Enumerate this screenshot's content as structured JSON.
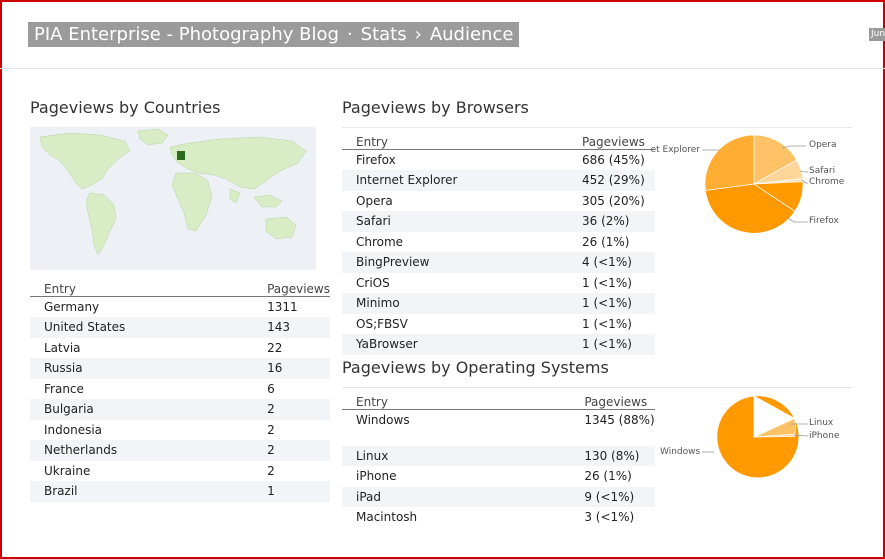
{
  "header": {
    "site": "PIA Enterprise - Photography Blog",
    "sep1": "·",
    "section": "Stats",
    "sep2": "›",
    "page": "Audience",
    "corner": "Jun"
  },
  "countries": {
    "title": "Pageviews by Countries",
    "col_entry": "Entry",
    "col_views": "Pageviews",
    "rows": [
      {
        "entry": "Germany",
        "views": "1311"
      },
      {
        "entry": "United States",
        "views": "143"
      },
      {
        "entry": "Latvia",
        "views": "22"
      },
      {
        "entry": "Russia",
        "views": "16"
      },
      {
        "entry": "France",
        "views": "6"
      },
      {
        "entry": "Bulgaria",
        "views": "2"
      },
      {
        "entry": "Indonesia",
        "views": "2"
      },
      {
        "entry": "Netherlands",
        "views": "2"
      },
      {
        "entry": "Ukraine",
        "views": "2"
      },
      {
        "entry": "Brazil",
        "views": "1"
      }
    ]
  },
  "browsers": {
    "title": "Pageviews by Browsers",
    "col_entry": "Entry",
    "col_views": "Pageviews",
    "rows": [
      {
        "entry": "Firefox",
        "views": "686 (45%)"
      },
      {
        "entry": "Internet Explorer",
        "views": "452 (29%)"
      },
      {
        "entry": "Opera",
        "views": "305 (20%)"
      },
      {
        "entry": "Safari",
        "views": "36 (2%)"
      },
      {
        "entry": "Chrome",
        "views": "26 (1%)"
      },
      {
        "entry": "BingPreview",
        "views": "4 (<1%)"
      },
      {
        "entry": "CriOS",
        "views": "1 (<1%)"
      },
      {
        "entry": "Minimo",
        "views": "1 (<1%)"
      },
      {
        "entry": "OS;FBSV",
        "views": "1 (<1%)"
      },
      {
        "entry": "YaBrowser",
        "views": "1 (<1%)"
      }
    ],
    "pie_labels": {
      "ie": "Internet Explorer",
      "opera": "Opera",
      "safari": "Safari",
      "chrome": "Chrome",
      "firefox": "Firefox"
    }
  },
  "os": {
    "title": "Pageviews by Operating Systems",
    "col_entry": "Entry",
    "col_views": "Pageviews",
    "rows": [
      {
        "entry": "Windows",
        "views": "1345 (88%)"
      },
      {
        "entry": "Linux",
        "views": "130 (8%)"
      },
      {
        "entry": "iPhone",
        "views": "26 (1%)"
      },
      {
        "entry": "iPad",
        "views": "9 (<1%)"
      },
      {
        "entry": "Macintosh",
        "views": "3 (<1%)"
      }
    ],
    "pie_labels": {
      "windows": "Windows",
      "linux": "Linux",
      "iphone": "iPhone"
    }
  },
  "colors": {
    "pie_main": "#ff9900",
    "pie_light": "#ffc266",
    "pie_lighter": "#ffd699",
    "map_country": "#2f6b1f",
    "map_land": "#d8ecc6"
  }
}
